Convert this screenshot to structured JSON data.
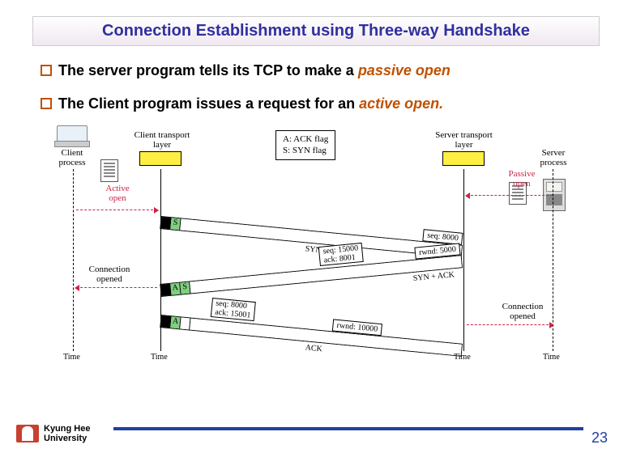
{
  "title": "Connection Establishment using Three-way Handshake",
  "bullets": [
    {
      "pre": "The server program  tells its TCP to make a ",
      "emph": "passive open"
    },
    {
      "pre": " The Client program issues a request for an ",
      "emph": "active open."
    }
  ],
  "diagram": {
    "headers": {
      "client_process": "Client\nprocess",
      "client_transport": "Client transport\nlayer",
      "server_transport": "Server transport\nlayer",
      "server_process": "Server\nprocess"
    },
    "legend": {
      "line1": "A: ACK flag",
      "line2": "S: SYN flag"
    },
    "active_open": "Active\nopen",
    "passive_open": "Passive\nopen",
    "connection_opened_left": "Connection\nopened",
    "connection_opened_right": "Connection\nopened",
    "seg1": {
      "seq": "seq: 8000",
      "flag_s": "S",
      "label": "SYN"
    },
    "seg2": {
      "seq": "seq: 15000",
      "ack": "ack: 8001",
      "rwnd": "rwnd: 5000",
      "flag_a": "A",
      "flag_s": "S",
      "label": "SYN + ACK"
    },
    "seg3": {
      "seq": "seq: 8000",
      "ack": "ack: 15001",
      "rwnd": "rwnd: 10000",
      "flag_a": "A",
      "label": "ACK"
    },
    "time": "Time"
  },
  "footer": {
    "uni1": "Kyung Hee",
    "uni2": "University"
  },
  "page": "23"
}
